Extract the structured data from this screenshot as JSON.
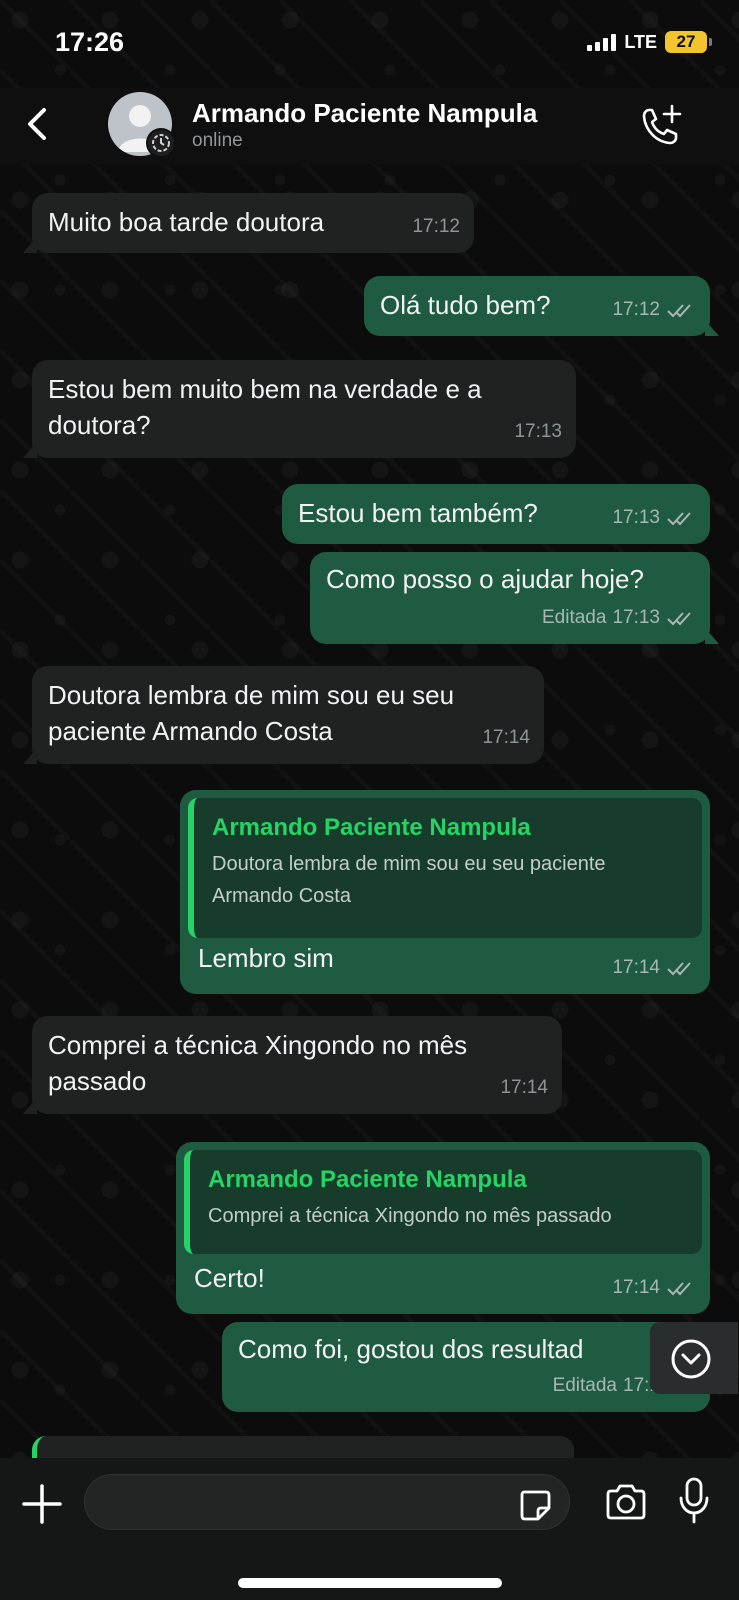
{
  "status_bar": {
    "time": "17:26",
    "network": "LTE",
    "battery": "27"
  },
  "header": {
    "contact_name": "Armando Paciente Nampula",
    "contact_status": "online"
  },
  "messages": [
    {
      "direction": "in",
      "text": "Muito boa tarde doutora",
      "time": "17:12"
    },
    {
      "direction": "out",
      "text": "Olá tudo bem?",
      "time": "17:12",
      "read": true
    },
    {
      "direction": "in",
      "text": "Estou bem muito bem na verdade e a\ndoutora?",
      "time": "17:13"
    },
    {
      "direction": "out",
      "text": "Estou bem também?",
      "time": "17:13",
      "read": true
    },
    {
      "direction": "out",
      "text": "Como posso o ajudar hoje?",
      "edited_label": "Editada",
      "time": "17:13",
      "read": true
    },
    {
      "direction": "in",
      "text": "Doutora lembra de mim sou eu seu\npaciente Armando Costa",
      "time": "17:14"
    },
    {
      "direction": "out",
      "quote_author": "Armando Paciente Nampula",
      "quote_text": "Doutora lembra de mim sou eu seu paciente\nArmando Costa",
      "text": "Lembro sim",
      "time": "17:14",
      "read": true
    },
    {
      "direction": "in",
      "text": "Comprei a técnica Xingondo no mês\npassado",
      "time": "17:14"
    },
    {
      "direction": "out",
      "quote_author": "Armando Paciente Nampula",
      "quote_text": "Comprei a técnica Xingondo no mês passado",
      "text": "Certo!",
      "time": "17:14",
      "read": true
    },
    {
      "direction": "out",
      "text": "Como foi, gostou dos resultad",
      "edited_label": "Editada",
      "time": "17:1",
      "read": true
    }
  ],
  "colors": {
    "incoming_bubble": "#202222",
    "outgoing_bubble": "#1f5b40",
    "accent_green": "#25d366",
    "battery": "#f3c52c"
  },
  "icons": {
    "back": "chevron-left-icon",
    "call": "add-call-icon",
    "scroll": "chevron-down-circle-icon",
    "attach": "plus-icon",
    "sticker": "sticker-icon",
    "camera": "camera-icon",
    "mic": "microphone-icon"
  }
}
